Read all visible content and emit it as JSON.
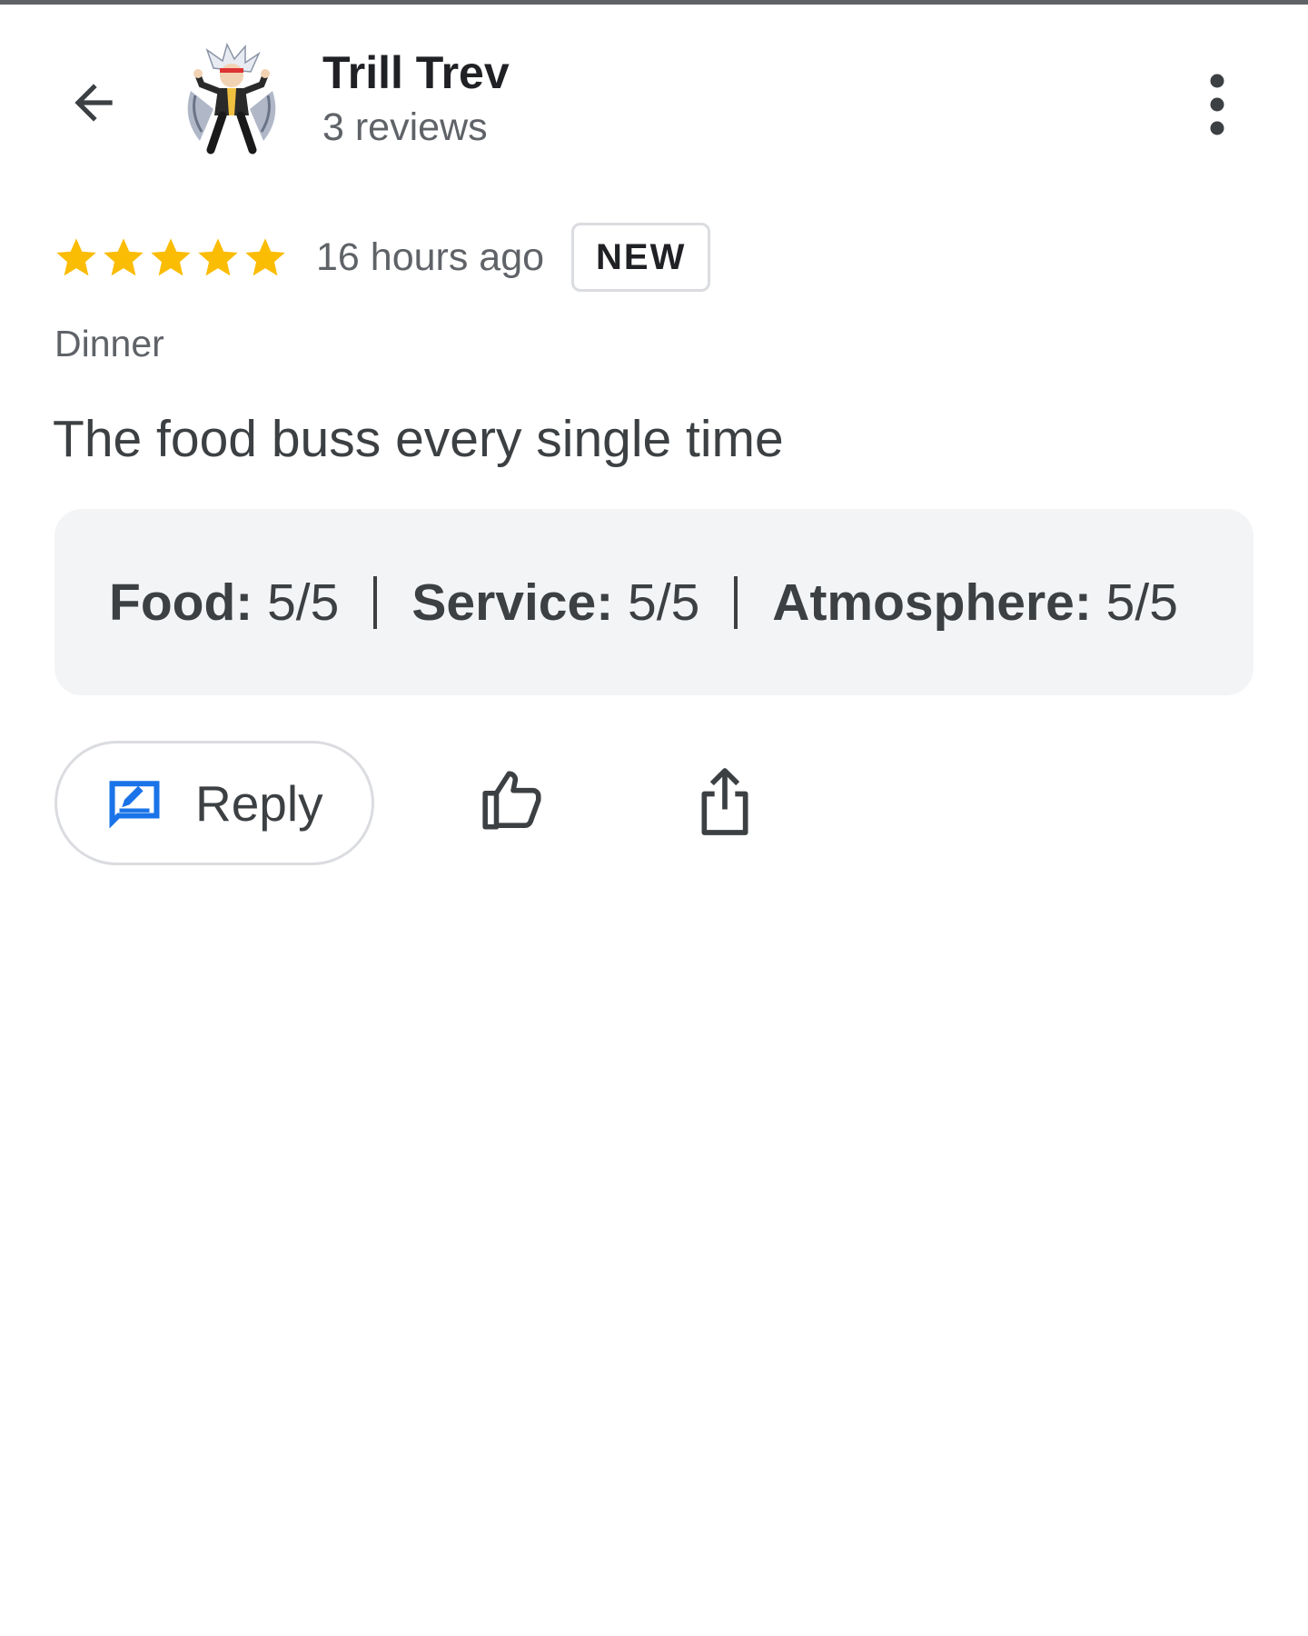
{
  "header": {
    "user_name": "Trill Trev",
    "review_count": "3 reviews"
  },
  "review": {
    "rating": 5,
    "rating_max": 5,
    "time_ago": "16 hours ago",
    "badge": "NEW",
    "meal_type": "Dinner",
    "text": "The food buss every single time",
    "sub_ratings": [
      {
        "label": "Food:",
        "value": "5/5"
      },
      {
        "label": "Service:",
        "value": "5/5"
      },
      {
        "label": "Atmosphere:",
        "value": "5/5"
      }
    ]
  },
  "actions": {
    "reply_label": "Reply"
  },
  "colors": {
    "star": "#fbbc04",
    "reply_icon": "#1a73e8",
    "icon_gray": "#3c4043",
    "ratings_bg": "#f3f4f6"
  },
  "icons": {
    "back": "arrow-left-icon",
    "more": "more-vertical-icon",
    "star": "star-icon",
    "reply": "reply-edit-icon",
    "like": "thumbs-up-icon",
    "share": "share-icon"
  }
}
